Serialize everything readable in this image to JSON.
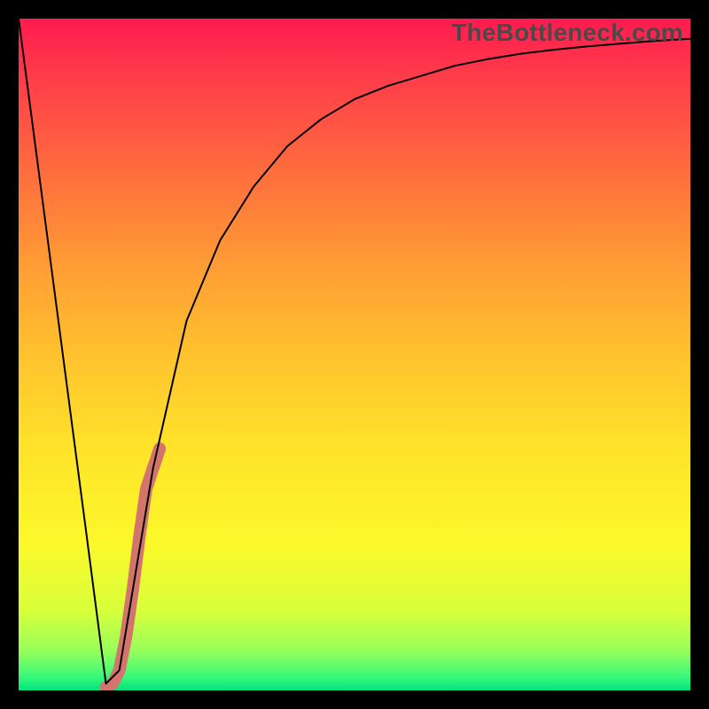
{
  "watermark": {
    "text": "TheBottleneck.com"
  },
  "chart_data": {
    "type": "line",
    "title": "",
    "xlabel": "",
    "ylabel": "",
    "xlim": [
      0,
      100
    ],
    "ylim": [
      0,
      100
    ],
    "grid": false,
    "series": [
      {
        "name": "bottleneck-curve",
        "color": "#000000",
        "stroke_width": 2,
        "x": [
          0,
          5,
          10,
          13,
          15,
          17,
          20,
          25,
          30,
          35,
          40,
          45,
          50,
          55,
          60,
          65,
          70,
          75,
          80,
          85,
          90,
          95,
          100
        ],
        "values": [
          100,
          62,
          24,
          1,
          3,
          15,
          33,
          55,
          67,
          75,
          81,
          85,
          88,
          90,
          91.5,
          93,
          94,
          94.8,
          95.4,
          95.9,
          96.3,
          96.7,
          97
        ]
      },
      {
        "name": "highlight-segment",
        "color": "#d4756d",
        "stroke_width": 14,
        "x": [
          13,
          14,
          15,
          16,
          17,
          18,
          19,
          20,
          21
        ],
        "values": [
          0.5,
          1,
          3,
          8,
          15,
          23,
          30,
          33,
          36
        ]
      }
    ]
  }
}
